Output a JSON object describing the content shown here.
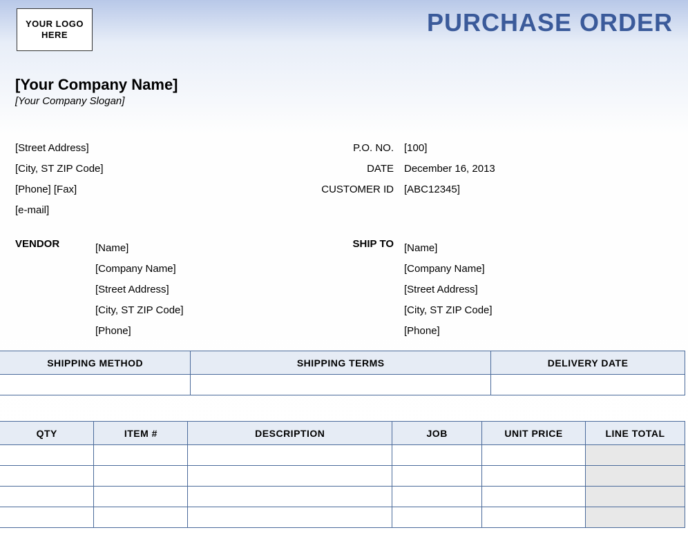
{
  "logo_text": "YOUR LOGO HERE",
  "title": "PURCHASE ORDER",
  "company": {
    "name": "[Your Company Name]",
    "slogan": "[Your Company Slogan]",
    "street": "[Street Address]",
    "city": "[City, ST  ZIP Code]",
    "phone_fax": "[Phone] [Fax]",
    "email": "[e-mail]"
  },
  "meta_labels": {
    "po_no": "P.O. NO.",
    "date": "DATE",
    "customer_id": "CUSTOMER ID"
  },
  "meta_values": {
    "po_no": "[100]",
    "date": "December 16, 2013",
    "customer_id": "[ABC12345]"
  },
  "vendor_label": "VENDOR",
  "shipto_label": "SHIP TO",
  "vendor": {
    "name": "[Name]",
    "company": "[Company Name]",
    "street": "[Street Address]",
    "city": "[City, ST  ZIP Code]",
    "phone": "[Phone]"
  },
  "shipto": {
    "name": "[Name]",
    "company": "[Company Name]",
    "street": "[Street Address]",
    "city": "[City, ST  ZIP Code]",
    "phone": "[Phone]"
  },
  "shipping_headers": {
    "method": "SHIPPING METHOD",
    "terms": "SHIPPING TERMS",
    "delivery": "DELIVERY DATE"
  },
  "item_headers": {
    "qty": "QTY",
    "item": "ITEM #",
    "desc": "DESCRIPTION",
    "job": "JOB",
    "unit": "UNIT PRICE",
    "line": "LINE TOTAL"
  }
}
